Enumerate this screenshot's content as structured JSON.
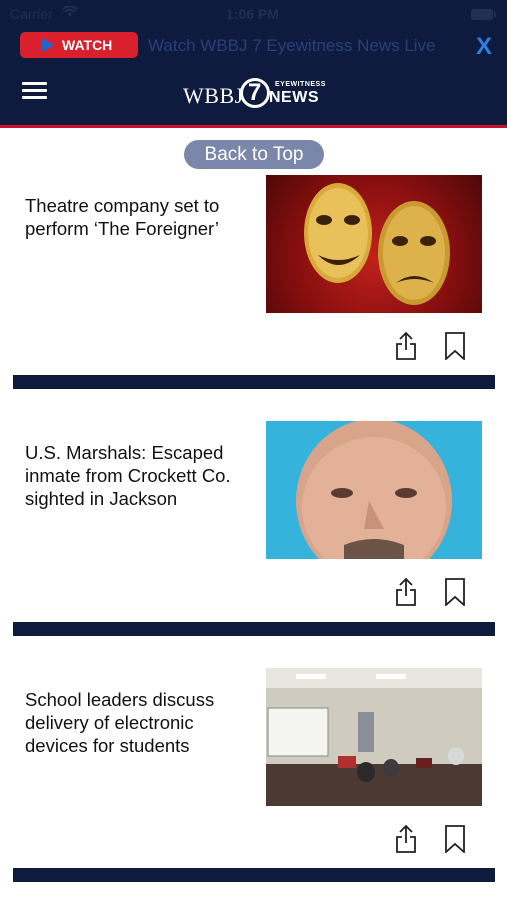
{
  "status_bar": {
    "carrier": "Carrier",
    "time": "1:06 PM"
  },
  "banner": {
    "watch_label": "WATCH",
    "ticker_text": "Watch WBBJ 7 Eyewitness News Live",
    "close_label": "X"
  },
  "logo": {
    "wordmark": "WBBJ",
    "channel": "7",
    "eyewitness": "EYEWITNESS",
    "news": "NEWS"
  },
  "back_to_top_label": "Back to Top",
  "articles": [
    {
      "title": "Theatre company set to perform ‘The Foreigner’",
      "image": "theatre-masks"
    },
    {
      "title": "U.S. Marshals: Escaped inmate from Crockett Co. sighted in Jackson",
      "image": "inmate-photo"
    },
    {
      "title": "School leaders discuss delivery of electronic devices for students",
      "image": "meeting-room"
    }
  ],
  "colors": {
    "navy": "#0e1a3e",
    "accent_red": "#d9202c",
    "close_blue": "#2f7fe0",
    "pill": "#7b87aa"
  }
}
